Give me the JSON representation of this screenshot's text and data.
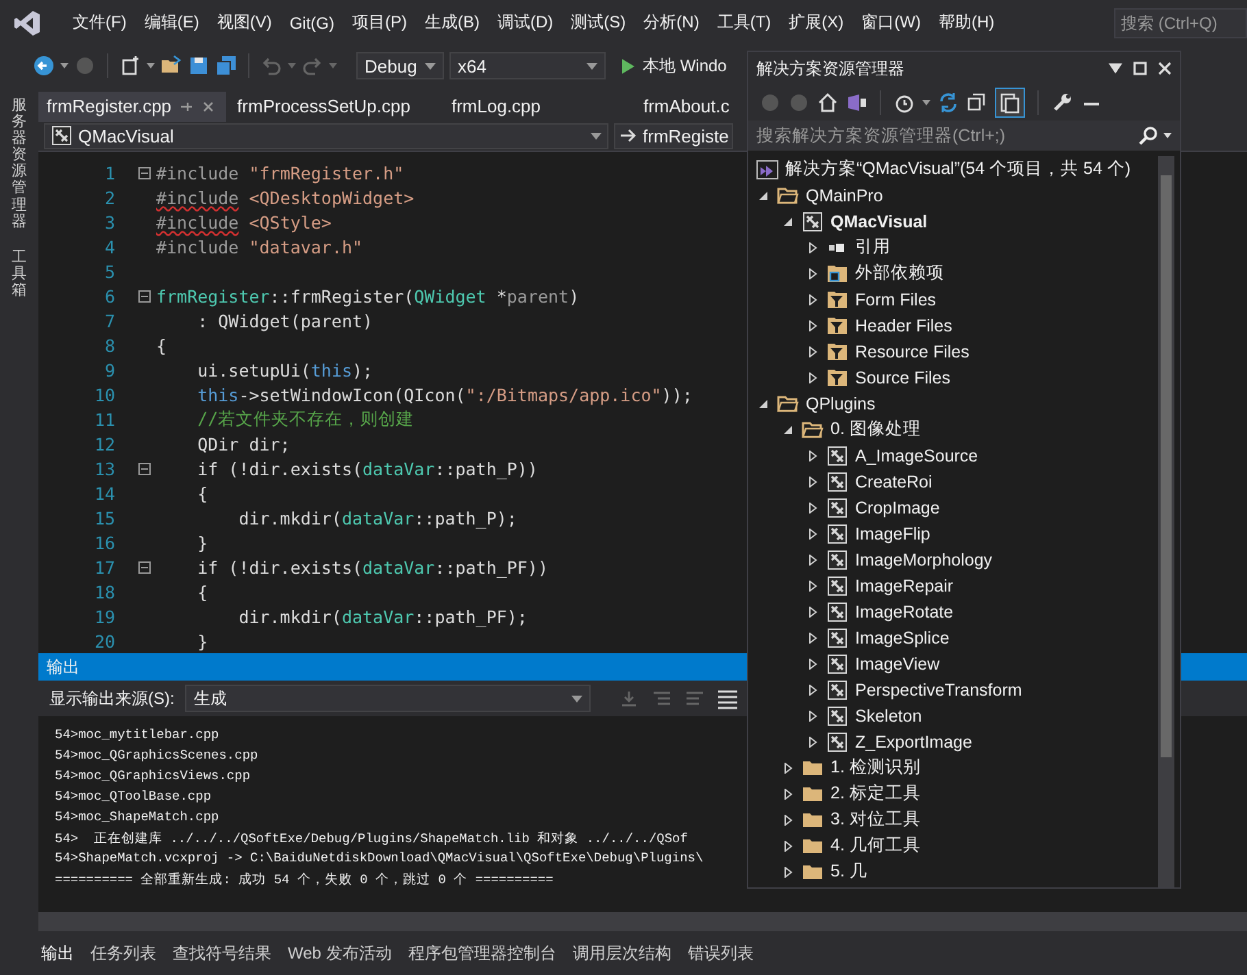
{
  "menu": [
    "文件(F)",
    "编辑(E)",
    "视图(V)",
    "Git(G)",
    "项目(P)",
    "生成(B)",
    "调试(D)",
    "测试(S)",
    "分析(N)",
    "工具(T)",
    "扩展(X)",
    "窗口(W)",
    "帮助(H)"
  ],
  "search": {
    "placeholder": "搜索 (Ctrl+Q)"
  },
  "toolbar": {
    "configuration": "Debug",
    "platform": "x64",
    "run_label": "本地 Windo"
  },
  "side_tabs": [
    "服务器资源管理器",
    "工具箱"
  ],
  "editor_tabs": [
    {
      "label": "frmRegister.cpp",
      "selected": true
    },
    {
      "label": "frmProcessSetUp.cpp",
      "selected": false
    },
    {
      "label": "frmLog.cpp",
      "selected": false
    },
    {
      "label": "frmAbout.c",
      "selected": false
    }
  ],
  "nav_bar": {
    "project": "QMacVisual",
    "scope": "frmRegiste"
  },
  "code_lines": [
    {
      "number": "1",
      "fold": true,
      "segments": [
        {
          "t": "#include",
          "kind": "macro"
        },
        {
          "t": " \"frmRegister.h\"",
          "kind": "str"
        }
      ]
    },
    {
      "number": "2",
      "fold": false,
      "segments": [
        {
          "t": "#include",
          "kind": "error"
        },
        {
          "t": " <QDesktopWidget>",
          "kind": "str"
        }
      ]
    },
    {
      "number": "3",
      "fold": false,
      "segments": [
        {
          "t": "#include",
          "kind": "error"
        },
        {
          "t": " <QStyle>",
          "kind": "str"
        }
      ]
    },
    {
      "number": "4",
      "fold": false,
      "segments": [
        {
          "t": "#include",
          "kind": "macro"
        },
        {
          "t": " \"datavar.h\"",
          "kind": "str"
        }
      ]
    },
    {
      "number": "5",
      "fold": false
    },
    {
      "number": "6",
      "fold": true,
      "segments": [
        {
          "t": "frmRegister",
          "kind": "type"
        },
        {
          "t": "::frmRegister(",
          "kind": "plain"
        },
        {
          "t": "QWidget",
          "kind": "type"
        },
        {
          "t": " *",
          "kind": "plain"
        },
        {
          "t": "parent",
          "kind": "param"
        },
        {
          "t": ")",
          "kind": "plain"
        }
      ]
    },
    {
      "number": "7",
      "fold": false,
      "segments": [
        {
          "t": "    : QWidget(parent)",
          "kind": "plain"
        }
      ]
    },
    {
      "number": "8",
      "fold": false,
      "segments": [
        {
          "t": "{",
          "kind": "plain"
        }
      ]
    },
    {
      "number": "9",
      "fold": false,
      "segments": [
        {
          "t": "    ui.setupUi(",
          "kind": "plain"
        },
        {
          "t": "this",
          "kind": "kw"
        },
        {
          "t": ");",
          "kind": "plain"
        }
      ]
    },
    {
      "number": "10",
      "fold": false,
      "segments": [
        {
          "t": "    this",
          "kind": "kw"
        },
        {
          "t": "->setWindowIcon(QIcon(",
          "kind": "plain"
        },
        {
          "t": "\":/Bitmaps/app.ico\"",
          "kind": "str"
        },
        {
          "t": "));",
          "kind": "plain"
        }
      ]
    },
    {
      "number": "11",
      "fold": false,
      "segments": [
        {
          "t": "    //若文件夹不存在，则创建",
          "kind": "comment"
        }
      ]
    },
    {
      "number": "12",
      "fold": false,
      "segments": [
        {
          "t": "    QDir dir;",
          "kind": "plain"
        }
      ]
    },
    {
      "number": "13",
      "fold": true,
      "segments": [
        {
          "t": "    if (!dir.exists(",
          "kind": "plain"
        },
        {
          "t": "dataVar",
          "kind": "type"
        },
        {
          "t": "::path_P))",
          "kind": "plain"
        }
      ]
    },
    {
      "number": "14",
      "fold": false,
      "segments": [
        {
          "t": "    {",
          "kind": "plain"
        }
      ]
    },
    {
      "number": "15",
      "fold": false,
      "segments": [
        {
          "t": "        dir.mkdir(",
          "kind": "plain"
        },
        {
          "t": "dataVar",
          "kind": "type"
        },
        {
          "t": "::path_P);",
          "kind": "plain"
        }
      ]
    },
    {
      "number": "16",
      "fold": false,
      "segments": [
        {
          "t": "    }",
          "kind": "plain"
        }
      ]
    },
    {
      "number": "17",
      "fold": true,
      "segments": [
        {
          "t": "    if (!dir.exists(",
          "kind": "plain"
        },
        {
          "t": "dataVar",
          "kind": "type"
        },
        {
          "t": "::path_PF))",
          "kind": "plain"
        }
      ]
    },
    {
      "number": "18",
      "fold": false,
      "segments": [
        {
          "t": "    {",
          "kind": "plain"
        }
      ]
    },
    {
      "number": "19",
      "fold": false,
      "segments": [
        {
          "t": "        dir.mkdir(",
          "kind": "plain"
        },
        {
          "t": "dataVar",
          "kind": "type"
        },
        {
          "t": "::path_PF);",
          "kind": "plain"
        }
      ]
    },
    {
      "number": "20",
      "fold": false,
      "segments": [
        {
          "t": "    }",
          "kind": "plain"
        }
      ]
    }
  ],
  "output": {
    "title": "输出",
    "source_label": "显示输出来源(S):",
    "source": "生成",
    "lines": [
      "54>moc_mytitlebar.cpp",
      "54>moc_QGraphicsScenes.cpp",
      "54>moc_QGraphicsViews.cpp",
      "54>moc_QToolBase.cpp",
      "54>moc_ShapeMatch.cpp",
      "54>  正在创建库 ../../../QSoftExe/Debug/Plugins/ShapeMatch.lib 和对象 ../../../QSof",
      "54>ShapeMatch.vcxproj -> C:\\BaiduNetdiskDownload\\QMacVisual\\QSoftExe\\Debug\\Plugins\\",
      "========== 全部重新生成: 成功 54 个，失败 0 个，跳过 0 个 =========="
    ]
  },
  "bottom_tabs": [
    {
      "label": "输出",
      "selected": true
    },
    {
      "label": "任务列表",
      "selected": false
    },
    {
      "label": "查找符号结果",
      "selected": false
    },
    {
      "label": "Web 发布活动",
      "selected": false
    },
    {
      "label": "程序包管理器控制台",
      "selected": false
    },
    {
      "label": "调用层次结构",
      "selected": false
    },
    {
      "label": "错误列表",
      "selected": false
    }
  ],
  "solution_explorer": {
    "title": "解决方案资源管理器",
    "show_all_active": true,
    "search": {
      "placeholder": "搜索解决方案资源管理器(Ctrl+;)"
    },
    "solution": {
      "label": "解决方案“QMacVisual”(54 个项目，共 54 个)",
      "children": [
        {
          "label": "QMainPro",
          "kind": "folder",
          "expanded": true,
          "children": [
            {
              "label": "QMacVisual",
              "kind": "project",
              "startup": true,
              "expanded": true,
              "children": [
                {
                  "label": "引用",
                  "kind": "references",
                  "expanded": false
                },
                {
                  "label": "外部依赖项",
                  "kind": "dependencies",
                  "expanded": false
                },
                {
                  "label": "Form Files",
                  "kind": "filter",
                  "expanded": false
                },
                {
                  "label": "Header Files",
                  "kind": "filter",
                  "expanded": false
                },
                {
                  "label": "Resource Files",
                  "kind": "filter",
                  "expanded": false
                },
                {
                  "label": "Source Files",
                  "kind": "filter",
                  "expanded": false
                }
              ]
            }
          ]
        },
        {
          "label": "QPlugins",
          "kind": "folder",
          "expanded": true,
          "children": [
            {
              "label": "0. 图像处理",
              "kind": "folder",
              "expanded": true,
              "children": [
                {
                  "label": "A_ImageSource",
                  "kind": "project",
                  "startup": false,
                  "expanded": false
                },
                {
                  "label": "CreateRoi",
                  "kind": "project",
                  "startup": false,
                  "expanded": false
                },
                {
                  "label": "CropImage",
                  "kind": "project",
                  "startup": false,
                  "expanded": false
                },
                {
                  "label": "ImageFlip",
                  "kind": "project",
                  "startup": false,
                  "expanded": false
                },
                {
                  "label": "ImageMorphology",
                  "kind": "project",
                  "startup": false,
                  "expanded": false
                },
                {
                  "label": "ImageRepair",
                  "kind": "project",
                  "startup": false,
                  "expanded": false
                },
                {
                  "label": "ImageRotate",
                  "kind": "project",
                  "startup": false,
                  "expanded": false
                },
                {
                  "label": "ImageSplice",
                  "kind": "project",
                  "startup": false,
                  "expanded": false
                },
                {
                  "label": "ImageView",
                  "kind": "project",
                  "startup": false,
                  "expanded": false
                },
                {
                  "label": "PerspectiveTransform",
                  "kind": "project",
                  "startup": false,
                  "expanded": false
                },
                {
                  "label": "Skeleton",
                  "kind": "project",
                  "startup": false,
                  "expanded": false
                },
                {
                  "label": "Z_ExportImage",
                  "kind": "project",
                  "startup": false,
                  "expanded": false
                }
              ]
            },
            {
              "label": "1. 检测识别",
              "kind": "folder",
              "expanded": false
            },
            {
              "label": "2. 标定工具",
              "kind": "folder",
              "expanded": false
            },
            {
              "label": "3. 对位工具",
              "kind": "folder",
              "expanded": false
            },
            {
              "label": "4. 几何工具",
              "kind": "folder",
              "expanded": false
            },
            {
              "label": "5. 几",
              "kind": "folder",
              "expanded": false
            }
          ]
        }
      ]
    }
  }
}
